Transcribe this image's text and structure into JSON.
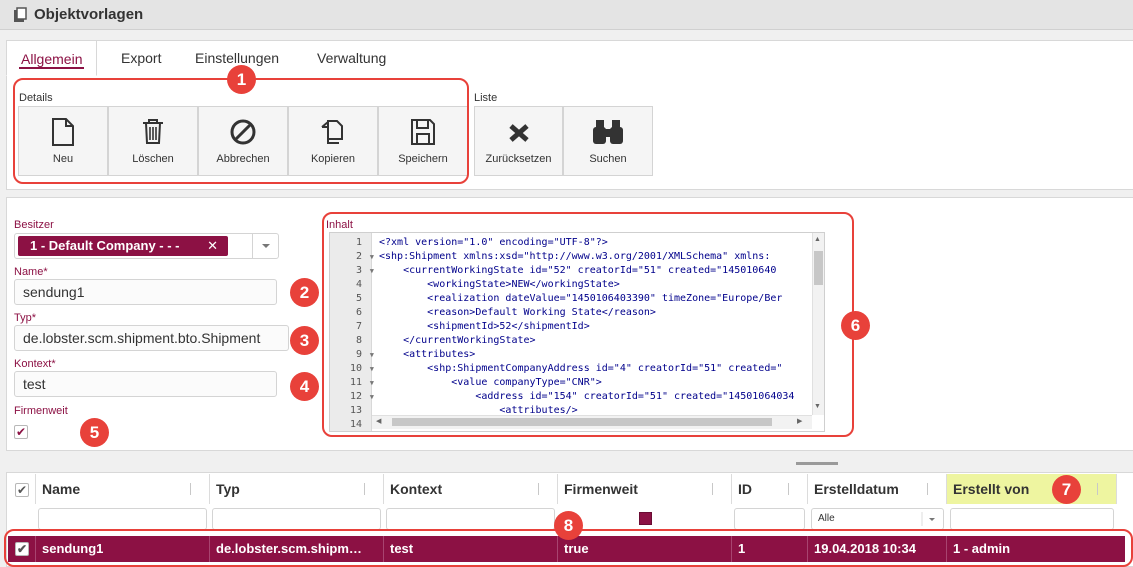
{
  "window": {
    "title": "Objektvorlagen",
    "icon": "clipboard-icon"
  },
  "tabs": [
    {
      "label": "Allgemein",
      "active": true
    },
    {
      "label": "Export",
      "active": false
    },
    {
      "label": "Einstellungen",
      "active": false
    },
    {
      "label": "Verwaltung",
      "active": false
    }
  ],
  "toolbar": {
    "details_label": "Details",
    "list_label": "Liste",
    "buttons": [
      {
        "label": "Neu",
        "icon": "new-document-icon"
      },
      {
        "label": "Löschen",
        "icon": "trash-icon"
      },
      {
        "label": "Abbrechen",
        "icon": "cancel-icon"
      },
      {
        "label": "Kopieren",
        "icon": "copy-icon"
      },
      {
        "label": "Speichern",
        "icon": "save-icon"
      },
      {
        "label": "Zurücksetzen",
        "icon": "reset-x-icon"
      },
      {
        "label": "Suchen",
        "icon": "binoculars-icon"
      }
    ]
  },
  "form": {
    "owner_label": "Besitzer",
    "owner_value": "1 - Default Company - - -",
    "owner_remove": "✕",
    "name_label": "Name",
    "name_value": "sendung1",
    "type_label": "Typ",
    "type_value": "de.lobster.scm.shipment.bto.Shipment",
    "context_label": "Kontext",
    "context_value": "test",
    "companywide_label": "Firmenweit",
    "companywide_checked": true,
    "required_mark": "*"
  },
  "editor": {
    "label": "Inhalt",
    "lines": [
      {
        "n": "1",
        "fold": false,
        "text": "<?xml version=\"1.0\" encoding=\"UTF-8\"?>"
      },
      {
        "n": "2",
        "fold": true,
        "text": "<shp:Shipment xmlns:xsd=\"http://www.w3.org/2001/XMLSchema\" xmlns:"
      },
      {
        "n": "3",
        "fold": true,
        "text": "    <currentWorkingState id=\"52\" creatorId=\"51\" created=\"145010640"
      },
      {
        "n": "4",
        "fold": false,
        "text": "        <workingState>NEW</workingState>"
      },
      {
        "n": "5",
        "fold": false,
        "text": "        <realization dateValue=\"1450106403390\" timeZone=\"Europe/Ber"
      },
      {
        "n": "6",
        "fold": false,
        "text": "        <reason>Default Working State</reason>"
      },
      {
        "n": "7",
        "fold": false,
        "text": "        <shipmentId>52</shipmentId>"
      },
      {
        "n": "8",
        "fold": false,
        "text": "    </currentWorkingState>"
      },
      {
        "n": "9",
        "fold": true,
        "text": "    <attributes>"
      },
      {
        "n": "10",
        "fold": true,
        "text": "        <shp:ShipmentCompanyAddress id=\"4\" creatorId=\"51\" created=\""
      },
      {
        "n": "11",
        "fold": true,
        "text": "            <value companyType=\"CNR\">"
      },
      {
        "n": "12",
        "fold": true,
        "text": "                <address id=\"154\" creatorId=\"51\" created=\"14501064034"
      },
      {
        "n": "13",
        "fold": false,
        "text": "                    <attributes/>"
      },
      {
        "n": "14",
        "fold": false,
        "text": ""
      }
    ]
  },
  "grid": {
    "columns": [
      "Name",
      "Typ",
      "Kontext",
      "Firmenweit",
      "ID",
      "Erstelldatum",
      "Erstellt von"
    ],
    "date_filter": "Alle",
    "rows": [
      {
        "checked": true,
        "name": "sendung1",
        "type": "de.lobster.scm.shipm…",
        "context": "test",
        "companywide": "true",
        "id": "1",
        "created": "19.04.2018 10:34",
        "created_by": "1 - admin"
      }
    ]
  },
  "markers": [
    "1",
    "2",
    "3",
    "4",
    "5",
    "6",
    "7",
    "8"
  ],
  "colors": {
    "accent": "#8c1144",
    "marker": "#e8413a",
    "highlight_header": "#eef5a0"
  }
}
